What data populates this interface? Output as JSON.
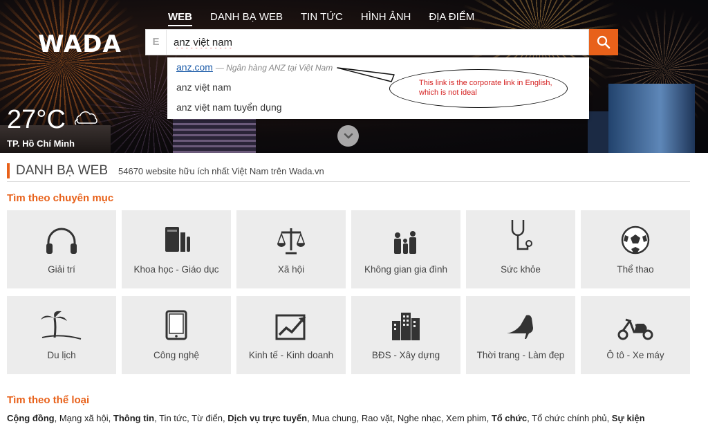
{
  "nav": {
    "logo": "WADA",
    "items": [
      {
        "label": "WEB",
        "active": true
      },
      {
        "label": "DANH BẠ WEB",
        "active": false
      },
      {
        "label": "TIN TỨC",
        "active": false
      },
      {
        "label": "HÌNH ẢNH",
        "active": false
      },
      {
        "label": "ĐỊA ĐIỂM",
        "active": false
      }
    ]
  },
  "search": {
    "prefix": "E",
    "value": "anz việt nam",
    "button_icon": "search-icon"
  },
  "suggestions": [
    {
      "link": "anz.com",
      "desc": "— Ngân hàng ANZ tại Việt Nam"
    },
    {
      "text": "anz việt nam"
    },
    {
      "text": "anz việt nam tuyển dụng"
    }
  ],
  "callout": {
    "text": "This link is the corporate link in English, which is not ideal"
  },
  "weather": {
    "temp": "27°C",
    "city": "TP. Hồ Chí Minh",
    "icon": "cloud-icon"
  },
  "directory": {
    "title": "DANH BẠ WEB",
    "subtitle": "54670 website hữu ích nhất Việt Nam trên Wada.vn"
  },
  "categories": {
    "heading": "Tìm theo chuyên mục",
    "items": [
      {
        "label": "Giải trí",
        "icon": "headphones-icon"
      },
      {
        "label": "Khoa học - Giáo dục",
        "icon": "books-icon"
      },
      {
        "label": "Xã hội",
        "icon": "scales-icon"
      },
      {
        "label": "Không gian gia đình",
        "icon": "family-icon"
      },
      {
        "label": "Sức khỏe",
        "icon": "stethoscope-icon"
      },
      {
        "label": "Thể thao",
        "icon": "soccer-ball-icon"
      },
      {
        "label": "Du lịch",
        "icon": "palm-tree-icon"
      },
      {
        "label": "Công nghệ",
        "icon": "tablet-icon"
      },
      {
        "label": "Kinh tế - Kinh doanh",
        "icon": "chart-icon"
      },
      {
        "label": "BĐS - Xây dựng",
        "icon": "buildings-icon"
      },
      {
        "label": "Thời trang - Làm đẹp",
        "icon": "high-heel-icon"
      },
      {
        "label": "Ô tô - Xe máy",
        "icon": "scooter-icon"
      }
    ]
  },
  "genres": {
    "heading": "Tìm theo thể loại",
    "items": [
      {
        "label": "Cộng đồng",
        "bold": true
      },
      {
        "label": "Mạng xã hội",
        "bold": false
      },
      {
        "label": "Thông tin",
        "bold": true
      },
      {
        "label": "Tin tức",
        "bold": false
      },
      {
        "label": "Từ điển",
        "bold": false
      },
      {
        "label": "Dịch vụ trực tuyến",
        "bold": true
      },
      {
        "label": "Mua chung",
        "bold": false
      },
      {
        "label": "Rao vặt",
        "bold": false
      },
      {
        "label": "Nghe nhạc",
        "bold": false
      },
      {
        "label": "Xem phim",
        "bold": false
      },
      {
        "label": "Tổ chức",
        "bold": true
      },
      {
        "label": "Tổ chức chính phủ",
        "bold": false
      },
      {
        "label": "Sự kiện",
        "bold": true
      }
    ]
  },
  "colors": {
    "accent": "#e8611a",
    "link": "#1a5aa8",
    "callout_text": "#d41d1d"
  }
}
